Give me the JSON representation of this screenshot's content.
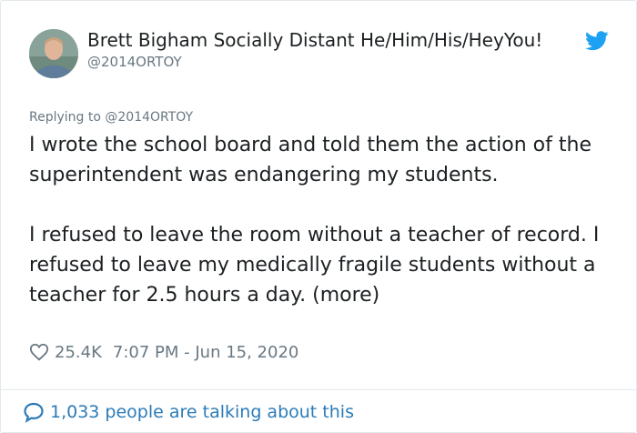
{
  "author": {
    "name": "Brett Bigham Socially Distant He/Him/His/HeyYou!",
    "handle": "@2014ORTOY",
    "avatar_icon": "user-avatar",
    "verified_icon": "twitter-bird-icon"
  },
  "replying_to": "Replying to @2014ORTOY",
  "tweet": {
    "paragraphs": [
      "I wrote the school board and told them the action of the superintendent was endangering my students.",
      "I refused to leave the room without a teacher of record. I refused to leave my medically fragile students without a teacher for 2.5 hours a day. (more)"
    ]
  },
  "meta": {
    "like_icon": "heart-icon",
    "likes": "25.4K",
    "timestamp": "7:07 PM - Jun 15, 2020"
  },
  "footer": {
    "icon": "speech-bubble-icon",
    "talking": "1,033 people are talking about this"
  },
  "colors": {
    "text": "#1c2022",
    "secondary": "#697882",
    "link": "#2b7bb9",
    "twitter_blue": "#1da1f2",
    "border": "#e3e8ec"
  }
}
